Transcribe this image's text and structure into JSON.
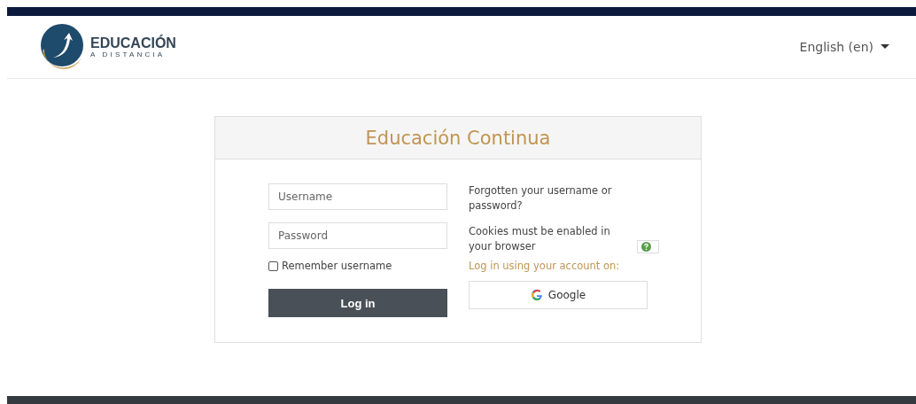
{
  "logo": {
    "title": "EDUCACIÓN",
    "subtitle": "A DISTANCIA"
  },
  "language": {
    "label": "English (en)"
  },
  "card": {
    "title": "Educación Continua"
  },
  "form": {
    "username": {
      "placeholder": "Username"
    },
    "password": {
      "placeholder": "Password"
    },
    "remember": {
      "label": "Remember username",
      "checked": false
    },
    "submit": "Log in"
  },
  "links": {
    "forgot": "Forgotten your username or password?",
    "cookies": "Cookies must be enabled in your browser",
    "login_with": "Log in using your account on:",
    "providers": [
      {
        "label": "Google"
      }
    ]
  }
}
